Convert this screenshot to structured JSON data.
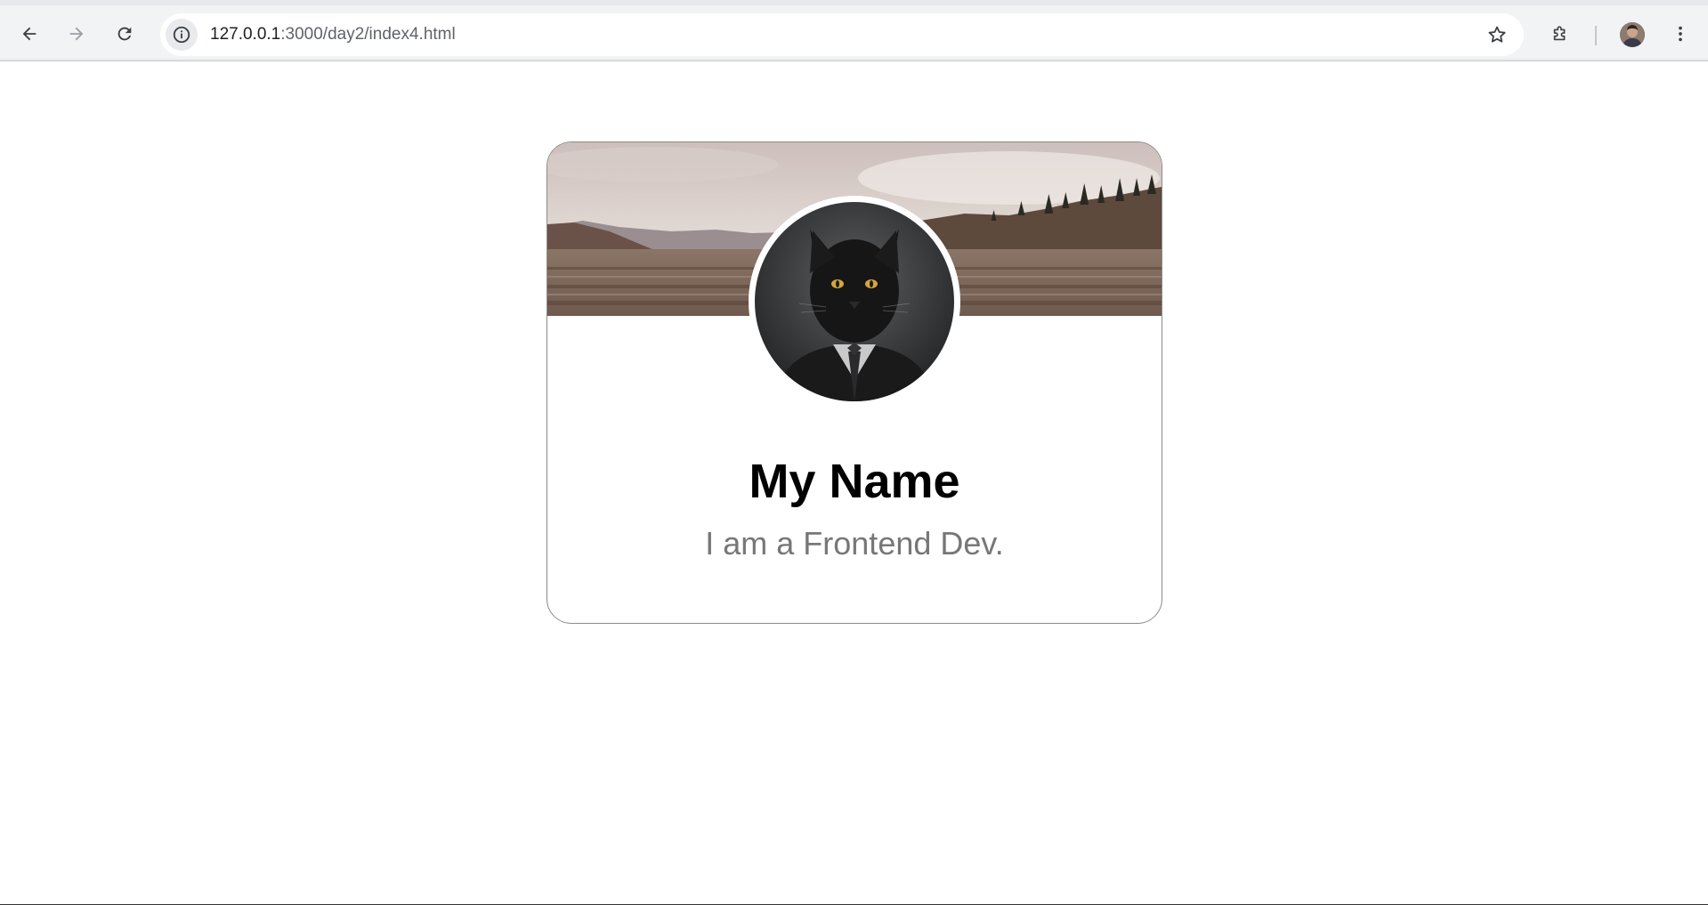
{
  "browser": {
    "url_host": "127.0.0.1",
    "url_path": ":3000/day2/index4.html",
    "icons": {
      "back": "arrow-left-icon",
      "forward": "arrow-right-icon",
      "reload": "reload-icon",
      "site_info": "info-icon",
      "bookmark": "star-icon",
      "extensions": "puzzle-icon",
      "profile": "avatar",
      "menu": "kebab-menu-icon"
    }
  },
  "profile_card": {
    "name": "My Name",
    "role": "I am a Frontend Dev.",
    "cover_image": "landscape road with mountains and pine trees",
    "profile_image": "black cat wearing suit and tie"
  },
  "colors": {
    "name_text": "#000000",
    "role_text": "#777777",
    "card_border": "#8a8a8a"
  }
}
